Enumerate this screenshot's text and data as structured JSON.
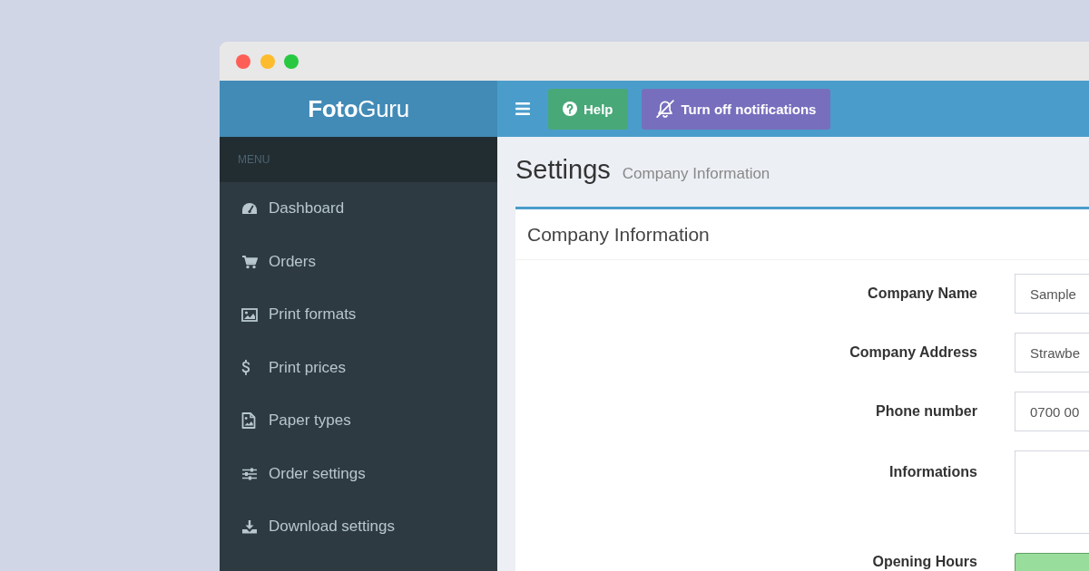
{
  "window_controls": [
    {
      "color": "#fd5f57"
    },
    {
      "color": "#fdbb2e"
    },
    {
      "color": "#28c840"
    }
  ],
  "header": {
    "logo": "**Foto**Guru",
    "buttons": [
      {
        "kind": "help",
        "label": "Help",
        "color": "#48a878"
      },
      {
        "kind": "notifications",
        "label": "Turn off notifications",
        "color": "#776fbd"
      }
    ]
  },
  "sidebar": {
    "heading": "MENU",
    "items": [
      {
        "kind": "dashboard",
        "label": "Dashboard",
        "selected": false
      },
      {
        "kind": "orders",
        "label": "Orders",
        "selected": false
      },
      {
        "kind": "formats",
        "label": "Print formats",
        "selected": false
      },
      {
        "kind": "prices",
        "label": "Print prices",
        "selected": false
      },
      {
        "kind": "paper",
        "label": "Paper types",
        "selected": false
      },
      {
        "kind": "order-settings",
        "label": "Order settings",
        "selected": false
      },
      {
        "kind": "download",
        "label": "Download settings",
        "selected": false
      }
    ]
  },
  "page": {
    "title": "Settings",
    "subtitle": "Company Information"
  },
  "card": {
    "title": "Company Information",
    "fields": [
      {
        "kind": "text",
        "label": "Company Name",
        "value": "Sample"
      },
      {
        "kind": "text",
        "label": "Company Address",
        "value": "Strawbe"
      },
      {
        "kind": "text",
        "label": "Phone number",
        "value": "0700 00"
      },
      {
        "kind": "textarea",
        "label": "Informations"
      },
      {
        "kind": "hours",
        "label": "Opening Hours"
      }
    ]
  }
}
